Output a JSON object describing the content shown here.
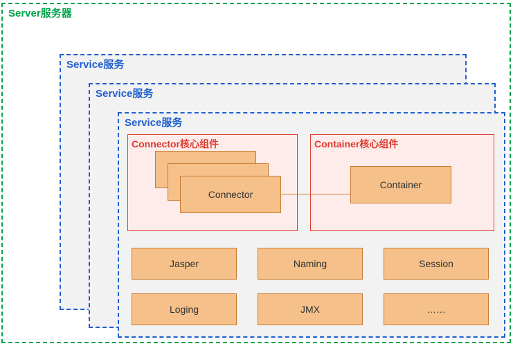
{
  "server": {
    "label": "Server服务器"
  },
  "services": [
    {
      "label": "Service服务"
    },
    {
      "label": "Service服务"
    },
    {
      "label": "Service服务"
    }
  ],
  "core": {
    "connector": {
      "title": "Connector核心组件",
      "box": "Connector"
    },
    "container": {
      "title": "Container核心组件",
      "box": "Container"
    }
  },
  "modules": {
    "row1": [
      "Jasper",
      "Naming",
      "Session"
    ],
    "row2": [
      "Loging",
      "JMX",
      "……"
    ]
  }
}
